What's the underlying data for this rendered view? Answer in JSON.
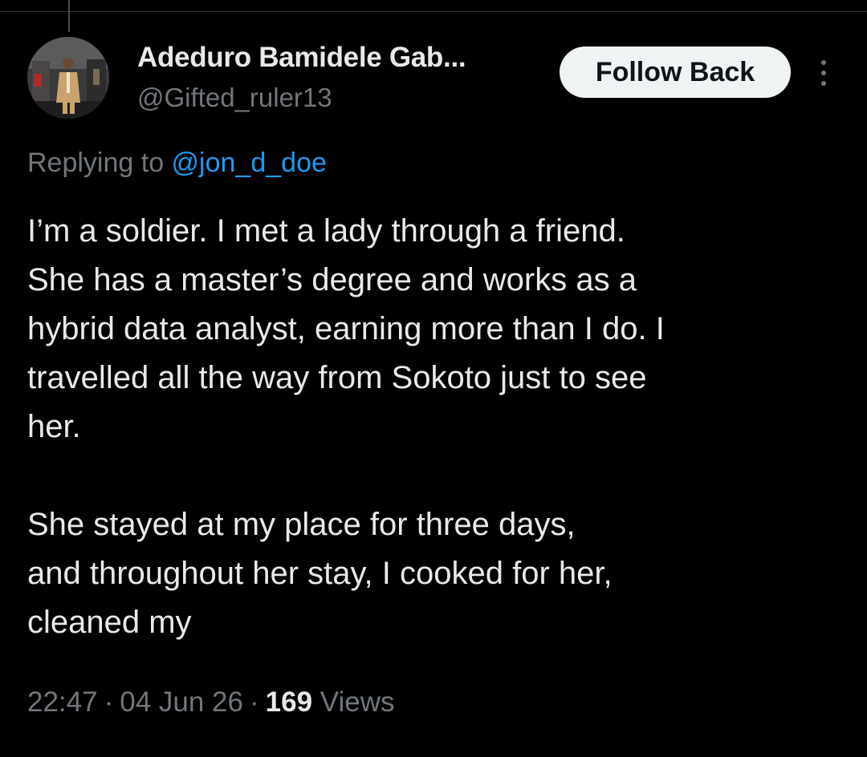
{
  "author": {
    "display_name": "Adeduro Bamidele Gab...",
    "handle": "@Gifted_ruler13",
    "avatar_icon": "profile-photo"
  },
  "actions": {
    "follow_label": "Follow Back",
    "more_icon": "more-vertical-icon"
  },
  "reply": {
    "prefix": "Replying to ",
    "mention": "@jon_d_doe"
  },
  "tweet": {
    "para1": [
      "I’m a soldier. I met a lady through a friend.",
      "She has a master’s degree and works as a",
      "hybrid data analyst, earning more than I do. I",
      "travelled all the way from Sokoto just to see",
      "her."
    ],
    "para2": [
      "She stayed at my place for three days,",
      "and throughout her stay, I cooked for her,",
      "cleaned my"
    ]
  },
  "meta": {
    "time": "22:47",
    "separator": "·",
    "date": "04 Jun 26",
    "views_count": "169",
    "views_label": "Views"
  },
  "colors": {
    "background": "#000000",
    "text_primary": "#e7e9ea",
    "text_secondary": "#71767b",
    "link": "#1d9bf0",
    "button_bg": "#eff3f4",
    "button_text": "#0f1419"
  }
}
